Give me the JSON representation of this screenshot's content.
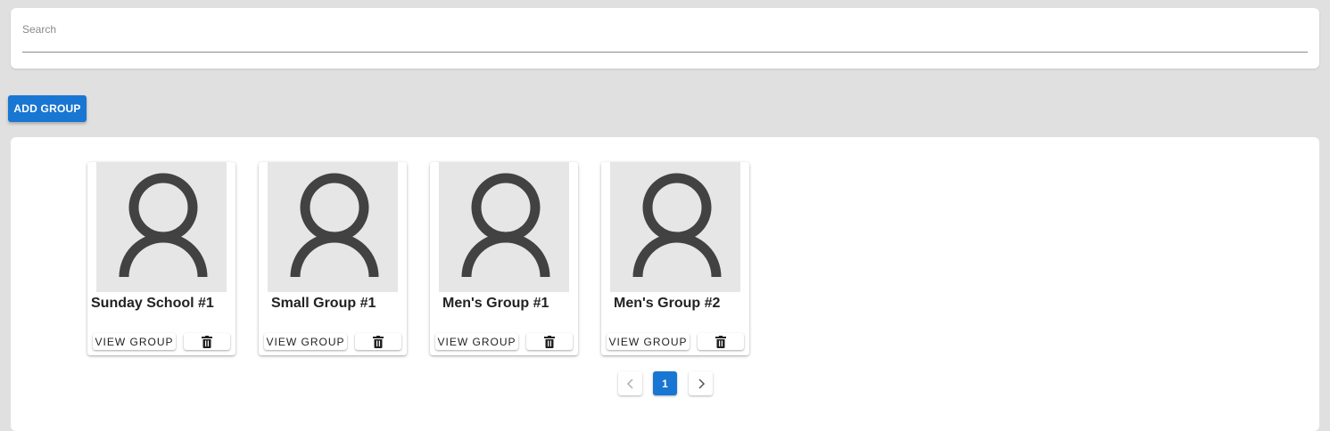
{
  "search": {
    "label": "Search",
    "value": ""
  },
  "add_button": {
    "label": "ADD GROUP"
  },
  "groups": [
    {
      "name": "Sunday School #1",
      "view_label": "VIEW GROUP",
      "icon": "user-placeholder"
    },
    {
      "name": "Small Group #1",
      "view_label": "VIEW GROUP",
      "icon": "user-placeholder"
    },
    {
      "name": "Men's Group #1",
      "view_label": "VIEW GROUP",
      "icon": "user-placeholder"
    },
    {
      "name": "Men's Group #2",
      "view_label": "VIEW GROUP",
      "icon": "user-placeholder"
    }
  ],
  "pagination": {
    "current": "1",
    "prev_icon": "chevron-left",
    "next_icon": "chevron-right"
  },
  "colors": {
    "primary": "#1976d2",
    "background": "#e0e0e0",
    "avatar_bg": "#e6e6e6",
    "avatar_icon": "#424242"
  }
}
